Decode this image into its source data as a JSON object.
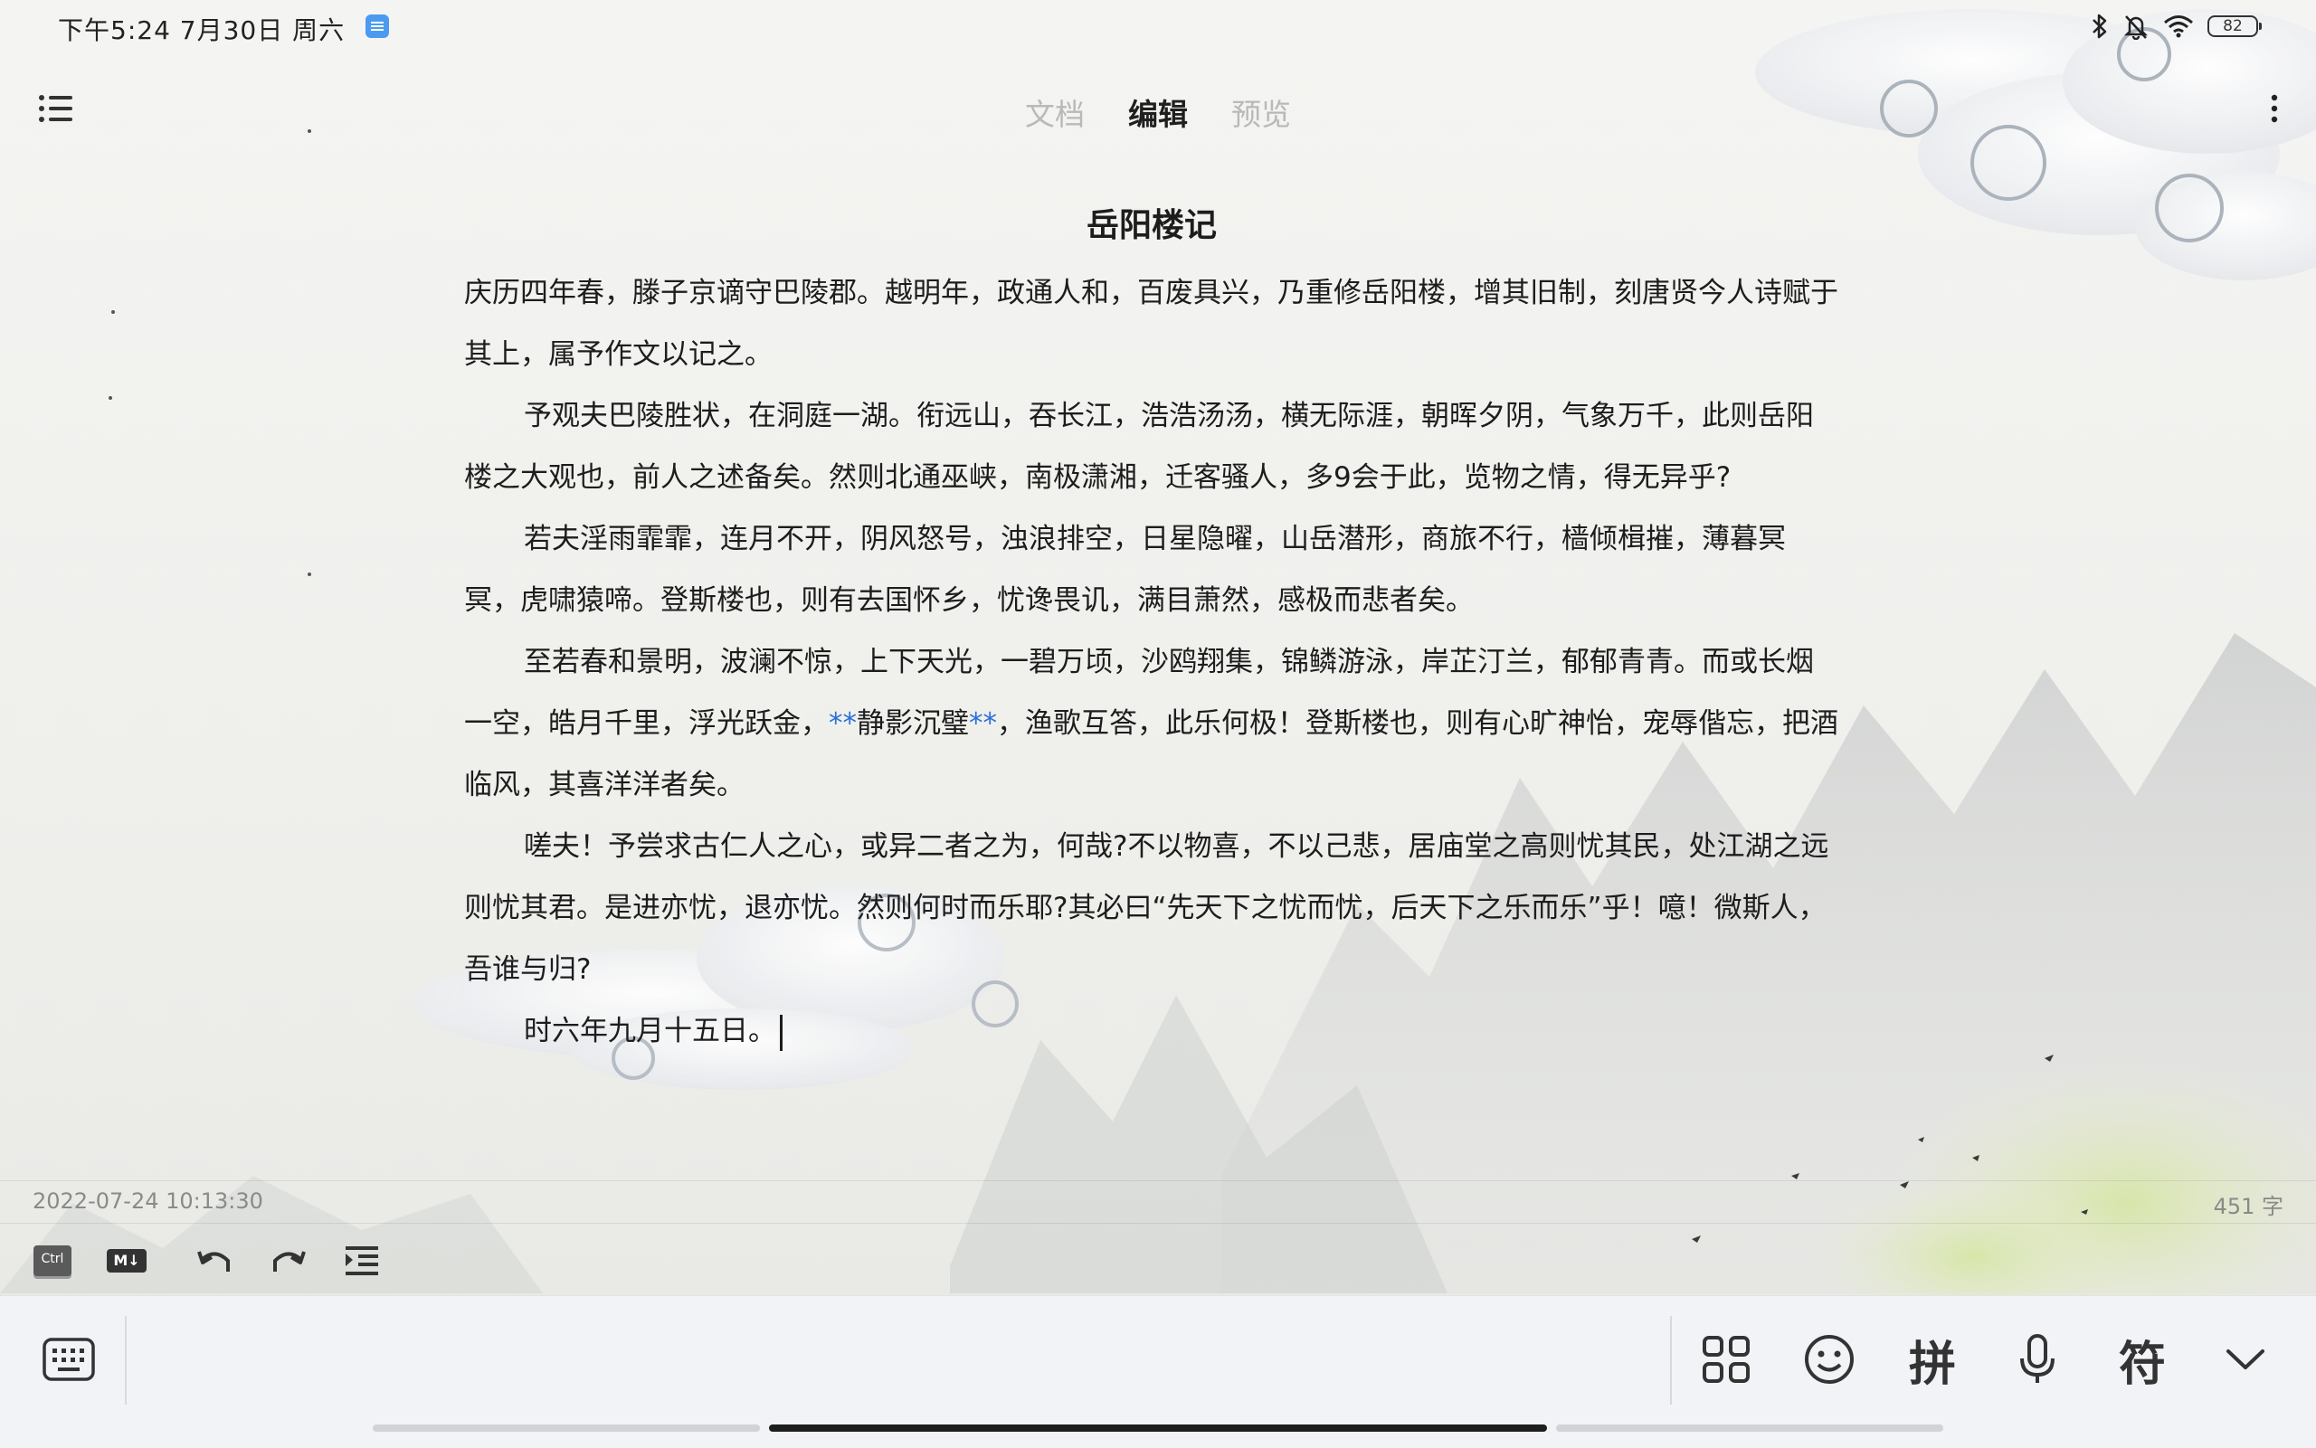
{
  "status_bar": {
    "time": "下午5:24  7月30日 周六",
    "battery": "82",
    "app_icon": "notes-app-icon",
    "icons": [
      "bluetooth-icon",
      "bell-muted-icon",
      "wifi-icon",
      "battery-icon"
    ]
  },
  "top_bar": {
    "menu_icon": "list-icon",
    "more_icon": "more-vertical-icon",
    "tabs": [
      {
        "label": "文档",
        "active": false
      },
      {
        "label": "编辑",
        "active": true
      },
      {
        "label": "预览",
        "active": false
      }
    ]
  },
  "document": {
    "title": "岳阳楼记",
    "paragraphs": [
      "庆历四年春，滕子京谪守巴陵郡。越明年，政通人和，百废具兴，乃重修岳阳楼，增其旧制，刻唐贤今人诗赋于其上，属予作文以记之。",
      "予观夫巴陵胜状，在洞庭一湖。衔远山，吞长江，浩浩汤汤，横无际涯，朝晖夕阴，气象万千，此则岳阳楼之大观也，前人之述备矣。然则北通巫峡，南极潇湘，迁客骚人，多9会于此，览物之情，得无异乎?",
      "若夫淫雨霏霏，连月不开，阴风怒号，浊浪排空，日星隐曜，山岳潜形，商旅不行，樯倾楫摧，薄暮冥冥，虎啸猿啼。登斯楼也，则有去国怀乡，忧谗畏讥，满目萧然，感极而悲者矣。"
    ],
    "para4": {
      "before": "至若春和景明，波澜不惊，上下天光，一碧万顷，沙鸥翔集，锦鳞游泳，岸芷汀兰，郁郁青青。而或长烟一空，皓月千里，浮光跃金，",
      "md_open": "**",
      "bold_text": "静影沉璧",
      "md_close": "**",
      "after": "，渔歌互答，此乐何极！登斯楼也，则有心旷神怡，宠辱偕忘，把酒临风，其喜洋洋者矣。"
    },
    "para5": "嗟夫！予尝求古仁人之心，或异二者之为，何哉?不以物喜，不以己悲，居庙堂之高则忧其民，处江湖之远则忧其君。是进亦忧，退亦忧。然则何时而乐耶?其必曰“先天下之忧而忧，后天下之乐而乐”乎！噫！微斯人，吾谁与归?",
    "para6": "时六年九月十五日。"
  },
  "info_bar": {
    "timestamp": "2022-07-24 10:13:30",
    "word_count": "451 字"
  },
  "editor_toolbar": {
    "ctrl_label": "Ctrl",
    "md_label": "M↓",
    "icons": [
      "ctrl-key-icon",
      "markdown-icon",
      "undo-icon",
      "redo-icon",
      "indent-icon"
    ]
  },
  "ime_bar": {
    "pinyin_label": "拼",
    "symbol_label": "符",
    "icons": [
      "keyboard-icon",
      "apps-grid-icon",
      "emoji-icon",
      "microphone-icon",
      "collapse-chevron-icon"
    ]
  },
  "colors": {
    "accent_md": "#2b6fd6",
    "text": "#1d1d1d",
    "tab_inactive": "#b9b9b9"
  }
}
